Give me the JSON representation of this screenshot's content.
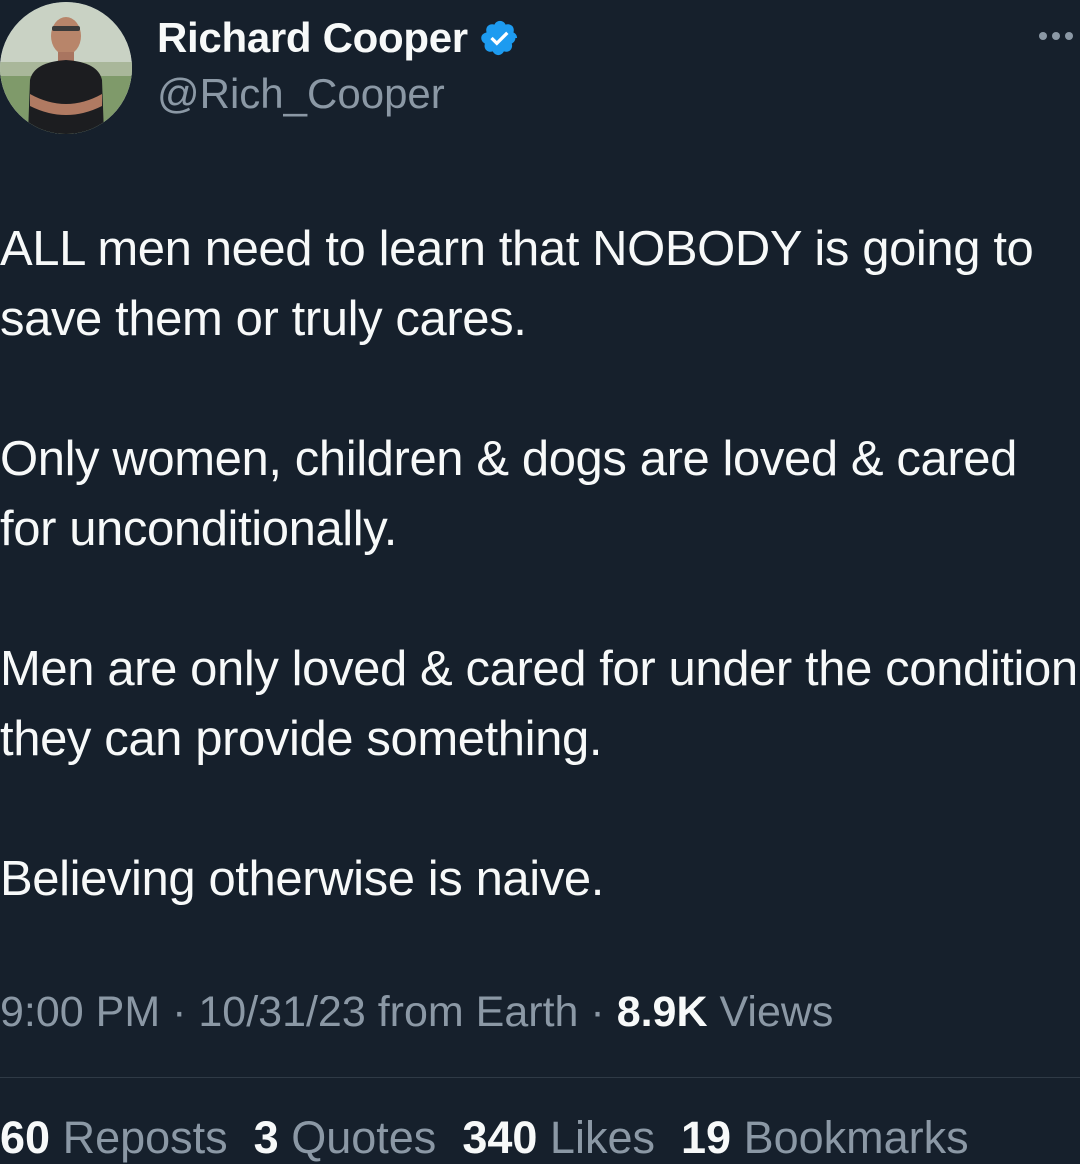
{
  "author": {
    "display_name": "Richard Cooper",
    "handle": "@Rich_Cooper",
    "verified": true,
    "verified_color": "#1d9bf0"
  },
  "tweet": {
    "paragraphs": [
      "ALL men need to learn that NOBODY is going to save them or truly cares.",
      "Only women, children & dogs are loved & cared for unconditionally.",
      "Men are only loved & cared for under the condition they can provide something.",
      "Believing otherwise is naive."
    ]
  },
  "meta": {
    "time": "9:00 PM",
    "date": "10/31/23",
    "source": "from Earth",
    "separator": "·",
    "views_count": "8.9K",
    "views_label": "Views"
  },
  "stats": {
    "reposts_count": "60",
    "reposts_label": "Reposts",
    "quotes_count": "3",
    "quotes_label": "Quotes",
    "likes_count": "340",
    "likes_label": "Likes",
    "bookmarks_count": "19",
    "bookmarks_label": "Bookmarks"
  },
  "icons": {
    "avatar": "avatar-photo",
    "verified": "verified-badge-icon",
    "more": "more-options-icon"
  },
  "colors": {
    "background": "#16202c",
    "text_primary": "#f7f9f9",
    "text_secondary": "#8b98a5"
  }
}
